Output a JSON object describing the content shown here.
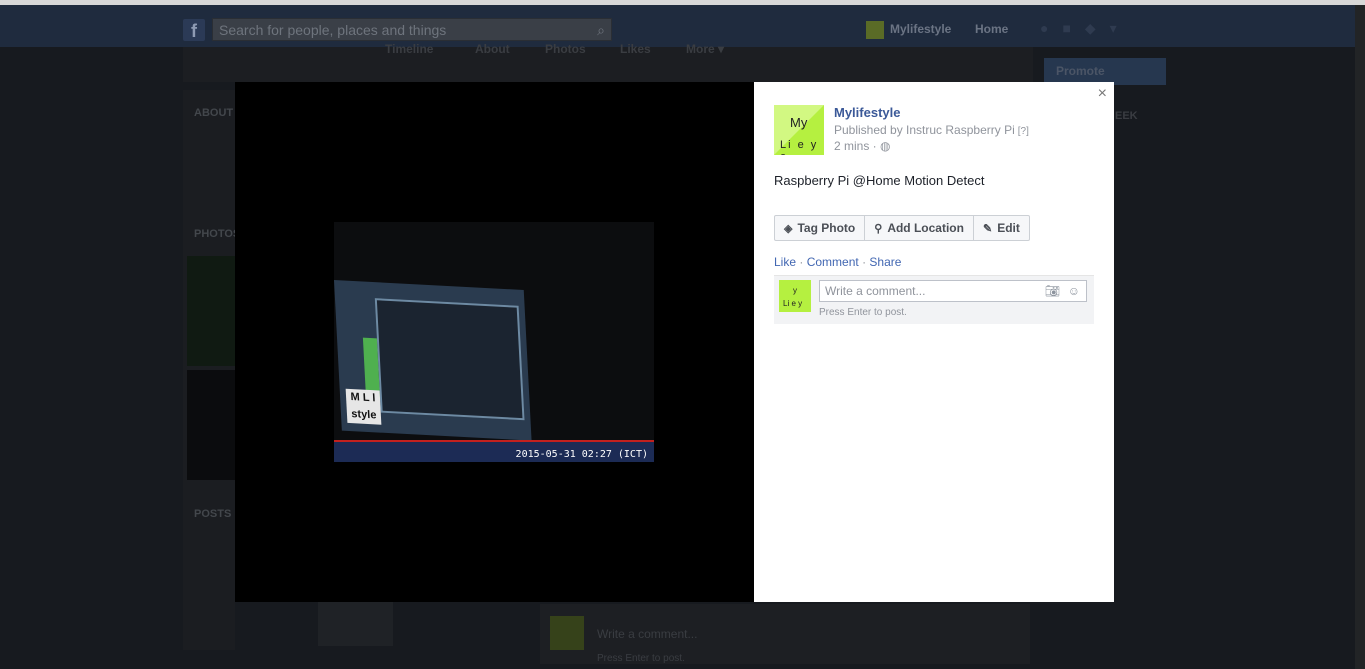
{
  "topbar": {
    "logo": "f",
    "search_placeholder": "Search for people, places and things",
    "page_shortcut": "Mylifestyle",
    "home": "Home"
  },
  "background": {
    "tabs": [
      "Timeline",
      "About",
      "Photos",
      "Likes",
      "More ▾"
    ],
    "left_labels": [
      "ABOUT",
      "PHOTOS",
      "POSTS"
    ],
    "right_promote": "Promote",
    "right_week": "EEK",
    "bottom_comment_placeholder": "Write a comment...",
    "bottom_hint": "Press Enter to post."
  },
  "photo": {
    "timestamp": "2015-05-31 02:27 (ICT)",
    "brand_mark": "M L l style"
  },
  "post": {
    "page_name": "Mylifestyle",
    "published_by": "Published by Instruc Raspberry Pi",
    "help": "[?]",
    "time": "2 mins ·",
    "caption": "Raspberry Pi @Home Motion Detect",
    "avatar_line1": "My",
    "avatar_line2": "Li e y e",
    "close": "×"
  },
  "actions": {
    "tag_photo": "Tag Photo",
    "add_location": "Add Location",
    "edit": "Edit"
  },
  "feedback": {
    "like": "Like",
    "comment": "Comment",
    "share": "Share",
    "sep": "·"
  },
  "comment": {
    "placeholder": "Write a comment...",
    "hint": "Press Enter to post.",
    "avatar_line1": "y",
    "avatar_line2": "Li e y"
  },
  "colors": {
    "link": "#3b5998",
    "avatar_green": "#b5f040",
    "topbar": "#1f2b3e"
  }
}
